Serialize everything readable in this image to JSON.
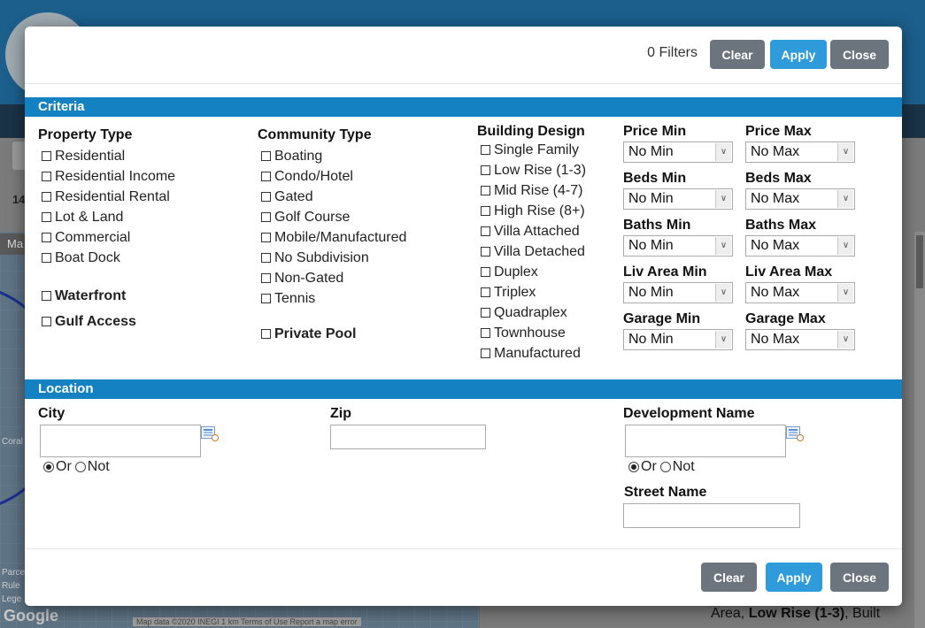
{
  "background": {
    "count_text": "14",
    "map_tab": "Ma",
    "google": "Google",
    "map_footer": "Map data ©2020 INEGI   1 km          Terms of Use   Report a map error",
    "side_labels": [
      "Coral Pi",
      "Parce",
      "Rule",
      "Lege"
    ],
    "listing_prefix": "Area, ",
    "listing_bold": "Low Rise (1-3)",
    "listing_suffix": ", Built"
  },
  "header": {
    "filter_count": "0 Filters",
    "clear_label": "Clear",
    "apply_label": "Apply",
    "close_label": "Close"
  },
  "criteria": {
    "title": "Criteria",
    "property_type": {
      "title": "Property Type",
      "items": [
        "Residential",
        "Residential Income",
        "Residential Rental",
        "Lot & Land",
        "Commercial",
        "Boat Dock"
      ],
      "extra": [
        "Waterfront",
        "Gulf Access"
      ]
    },
    "community_type": {
      "title": "Community Type",
      "items": [
        "Boating",
        "Condo/Hotel",
        "Gated",
        "Golf Course",
        "Mobile/Manufactured",
        "No Subdivision",
        "Non-Gated",
        "Tennis"
      ],
      "extra": [
        "Private Pool"
      ]
    },
    "building_design": {
      "title": "Building Design",
      "items": [
        "Single Family",
        "Low Rise (1-3)",
        "Mid Rise (4-7)",
        "High Rise (8+)",
        "Villa Attached",
        "Villa Detached",
        "Duplex",
        "Triplex",
        "Quadraplex",
        "Townhouse",
        "Manufactured"
      ]
    },
    "ranges": [
      {
        "min_label": "Price Min",
        "min_value": "No Min",
        "max_label": "Price Max",
        "max_value": "No Max"
      },
      {
        "min_label": "Beds Min",
        "min_value": "No Min",
        "max_label": "Beds Max",
        "max_value": "No Max"
      },
      {
        "min_label": "Baths Min",
        "min_value": "No Min",
        "max_label": "Baths Max",
        "max_value": "No Max"
      },
      {
        "min_label": "Liv Area Min",
        "min_value": "No Min",
        "max_label": "Liv Area Max",
        "max_value": "No Max"
      },
      {
        "min_label": "Garage Min",
        "min_value": "No Min",
        "max_label": "Garage Max",
        "max_value": "No Max"
      }
    ]
  },
  "location": {
    "title": "Location",
    "city_label": "City",
    "zip_label": "Zip",
    "development_label": "Development Name",
    "street_label": "Street Name",
    "or_label": "Or",
    "not_label": "Not",
    "city_value": "",
    "zip_value": "",
    "development_value": "",
    "street_value": ""
  },
  "footer": {
    "clear_label": "Clear",
    "apply_label": "Apply",
    "close_label": "Close"
  }
}
